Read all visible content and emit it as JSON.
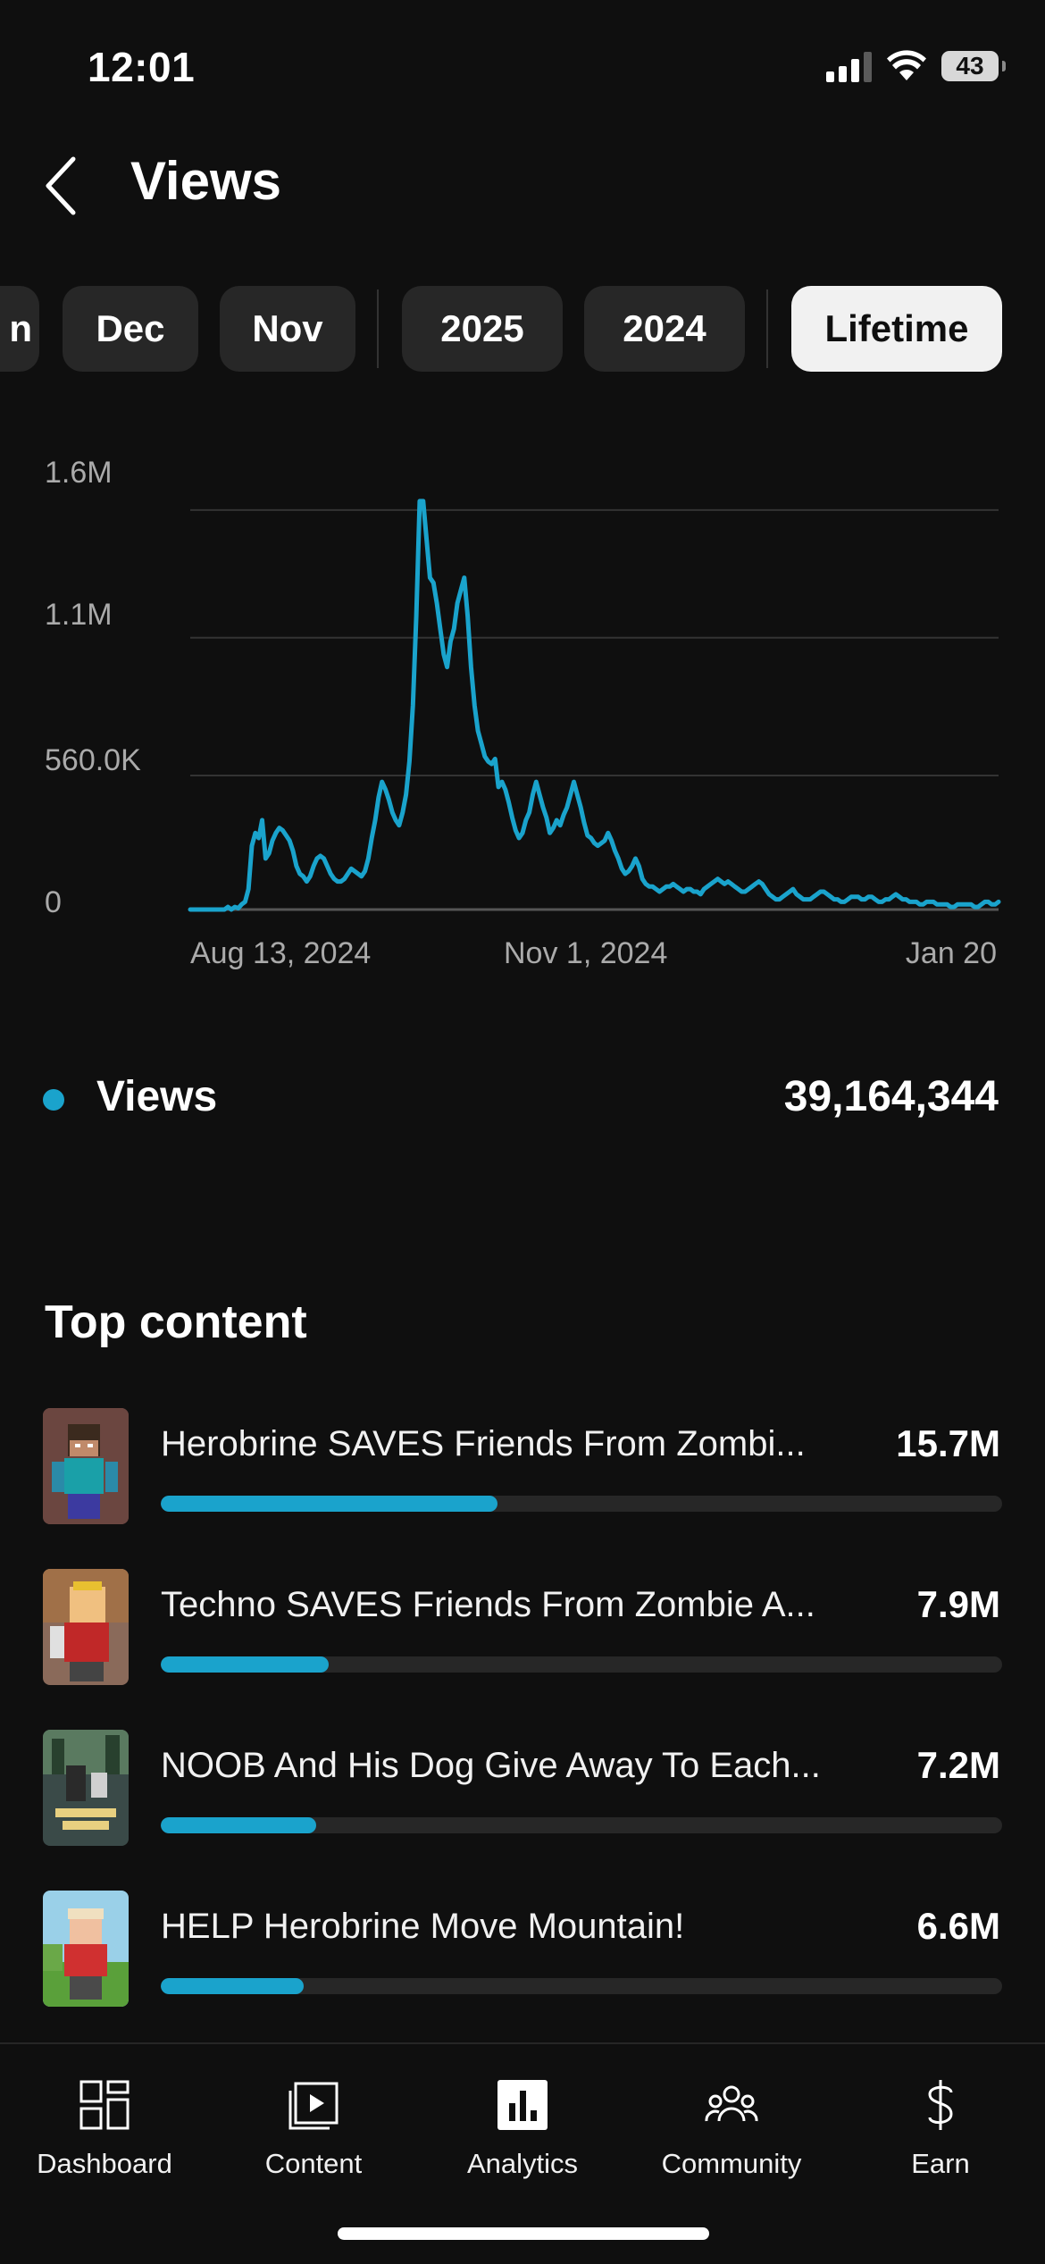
{
  "status_bar": {
    "time": "12:01",
    "battery": "43",
    "icons": [
      "cellular-signal-icon",
      "wifi-icon",
      "battery-icon"
    ]
  },
  "header": {
    "title": "Views",
    "back_icon": "chevron-left-icon"
  },
  "filters": {
    "chips": [
      {
        "label": "n",
        "active": false
      },
      {
        "label": "Dec",
        "active": false
      },
      {
        "label": "Nov",
        "active": false
      },
      {
        "label": "2025",
        "active": false
      },
      {
        "label": "2024",
        "active": false
      },
      {
        "label": "Lifetime",
        "active": true
      }
    ]
  },
  "chart_data": {
    "type": "line",
    "title": "",
    "xlabel": "",
    "ylabel": "",
    "x_tick_labels": [
      "Aug 13, 2024",
      "Nov 1, 2024",
      "Jan 20"
    ],
    "y_tick_labels": [
      "1.6M",
      "1.1M",
      "560.0K",
      "0"
    ],
    "ylim": [
      0,
      1680000
    ],
    "grid": true,
    "series": [
      {
        "name": "Views",
        "color": "#1aa3cc",
        "values": [
          0,
          0,
          0,
          0,
          0,
          0,
          0,
          0,
          0,
          0,
          0,
          10000,
          0,
          10000,
          5000,
          20000,
          30000,
          80000,
          250000,
          300000,
          280000,
          350000,
          200000,
          220000,
          270000,
          300000,
          320000,
          310000,
          290000,
          270000,
          230000,
          170000,
          140000,
          130000,
          110000,
          130000,
          170000,
          200000,
          210000,
          200000,
          170000,
          140000,
          120000,
          110000,
          110000,
          120000,
          140000,
          160000,
          150000,
          140000,
          130000,
          150000,
          200000,
          280000,
          350000,
          440000,
          500000,
          470000,
          430000,
          380000,
          350000,
          330000,
          380000,
          450000,
          580000,
          800000,
          1150000,
          1600000,
          1600000,
          1450000,
          1300000,
          1280000,
          1200000,
          1100000,
          1000000,
          950000,
          1050000,
          1100000,
          1200000,
          1250000,
          1300000,
          1150000,
          950000,
          800000,
          700000,
          650000,
          600000,
          580000,
          570000,
          590000,
          480000,
          500000,
          470000,
          420000,
          360000,
          310000,
          280000,
          300000,
          350000,
          380000,
          450000,
          500000,
          450000,
          400000,
          360000,
          300000,
          320000,
          350000,
          330000,
          370000,
          400000,
          450000,
          500000,
          450000,
          400000,
          340000,
          290000,
          280000,
          260000,
          250000,
          260000,
          270000,
          300000,
          270000,
          230000,
          200000,
          160000,
          140000,
          150000,
          170000,
          200000,
          170000,
          120000,
          100000,
          90000,
          90000,
          80000,
          70000,
          80000,
          90000,
          90000,
          100000,
          90000,
          80000,
          70000,
          80000,
          80000,
          70000,
          70000,
          60000,
          80000,
          90000,
          100000,
          110000,
          120000,
          110000,
          100000,
          110000,
          100000,
          90000,
          80000,
          70000,
          70000,
          80000,
          90000,
          100000,
          110000,
          100000,
          80000,
          60000,
          50000,
          40000,
          40000,
          50000,
          60000,
          70000,
          80000,
          60000,
          50000,
          40000,
          40000,
          40000,
          50000,
          60000,
          70000,
          70000,
          60000,
          50000,
          40000,
          40000,
          30000,
          30000,
          40000,
          50000,
          50000,
          50000,
          40000,
          40000,
          50000,
          50000,
          40000,
          30000,
          30000,
          40000,
          40000,
          50000,
          60000,
          50000,
          40000,
          40000,
          30000,
          30000,
          30000,
          20000,
          20000,
          30000,
          30000,
          30000,
          20000,
          20000,
          20000,
          20000,
          10000,
          10000,
          20000,
          20000,
          20000,
          20000,
          20000,
          10000,
          10000,
          20000,
          30000,
          30000,
          20000,
          20000,
          30000
        ]
      }
    ]
  },
  "legend": {
    "label": "Views",
    "total": "39,164,344",
    "color": "#1aa3cc"
  },
  "top_content": {
    "title": "Top content",
    "items": [
      {
        "title": "Herobrine SAVES Friends From Zombi...",
        "value": "15.7M",
        "share": 0.4
      },
      {
        "title": "Techno SAVES Friends From Zombie A...",
        "value": "7.9M",
        "share": 0.2
      },
      {
        "title": "NOOB And His Dog Give Away To Each...",
        "value": "7.2M",
        "share": 0.185
      },
      {
        "title": "HELP Herobrine Move Mountain!",
        "value": "6.6M",
        "share": 0.17
      }
    ]
  },
  "bottom_nav": {
    "items": [
      {
        "label": "Dashboard",
        "icon": "dashboard-icon"
      },
      {
        "label": "Content",
        "icon": "content-icon"
      },
      {
        "label": "Analytics",
        "icon": "analytics-icon",
        "active": true
      },
      {
        "label": "Community",
        "icon": "community-icon"
      },
      {
        "label": "Earn",
        "icon": "dollar-icon"
      }
    ]
  }
}
